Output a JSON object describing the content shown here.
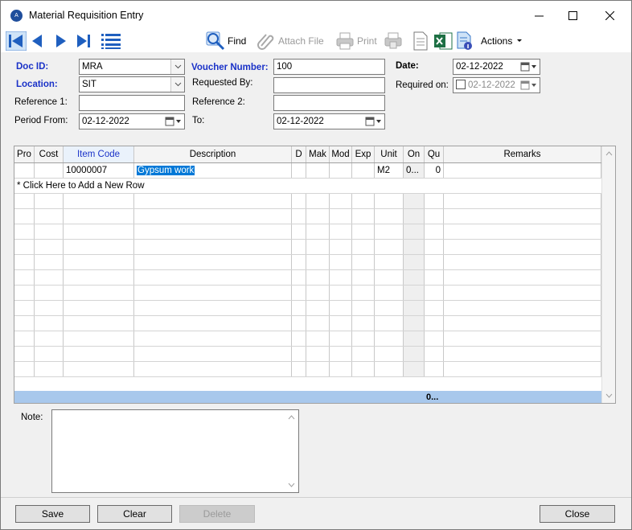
{
  "window": {
    "title": "Material Requisition Entry",
    "app_icon_text": "A"
  },
  "toolbar": {
    "find_label": "Find",
    "attach_label": "Attach File",
    "print_label": "Print",
    "actions_label": "Actions"
  },
  "form": {
    "doc_id_label": "Doc ID:",
    "doc_id_value": "MRA",
    "location_label": "Location:",
    "location_value": "SIT",
    "reference1_label": "Reference 1:",
    "reference1_value": "",
    "period_from_label": "Period From:",
    "period_from_value": "02-12-2022",
    "voucher_label": "Voucher Number:",
    "voucher_value": "100",
    "requested_by_label": "Requested By:",
    "requested_by_value": "",
    "reference2_label": "Reference 2:",
    "reference2_value": "",
    "to_label": "To:",
    "to_value": "02-12-2022",
    "date_label": "Date:",
    "date_value": "02-12-2022",
    "required_on_label": "Required on:",
    "required_on_value": "02-12-2022"
  },
  "grid": {
    "columns": [
      "Pro",
      "Cost",
      "Item Code",
      "Description",
      "D",
      "Mak",
      "Mod",
      "Exp",
      "Unit",
      "On",
      "Qu",
      "Remarks"
    ],
    "rows": [
      {
        "pro": "",
        "cost": "",
        "item_code": "10000007",
        "description": "Gypsum work",
        "d": "",
        "mak": "",
        "mod": "",
        "exp": "",
        "unit": "M2",
        "on": "0...",
        "qu": "0",
        "remarks": ""
      }
    ],
    "new_row_text": "* Click Here to Add a New Row",
    "footer_total": "0..."
  },
  "note": {
    "label": "Note:",
    "value": ""
  },
  "buttons": {
    "save": "Save",
    "clear": "Clear",
    "delete": "Delete",
    "close": "Close"
  },
  "colors": {
    "label_blue": "#1a32c8",
    "accent_blue": "#0078d7",
    "footer_blue": "#a8c8ec"
  }
}
